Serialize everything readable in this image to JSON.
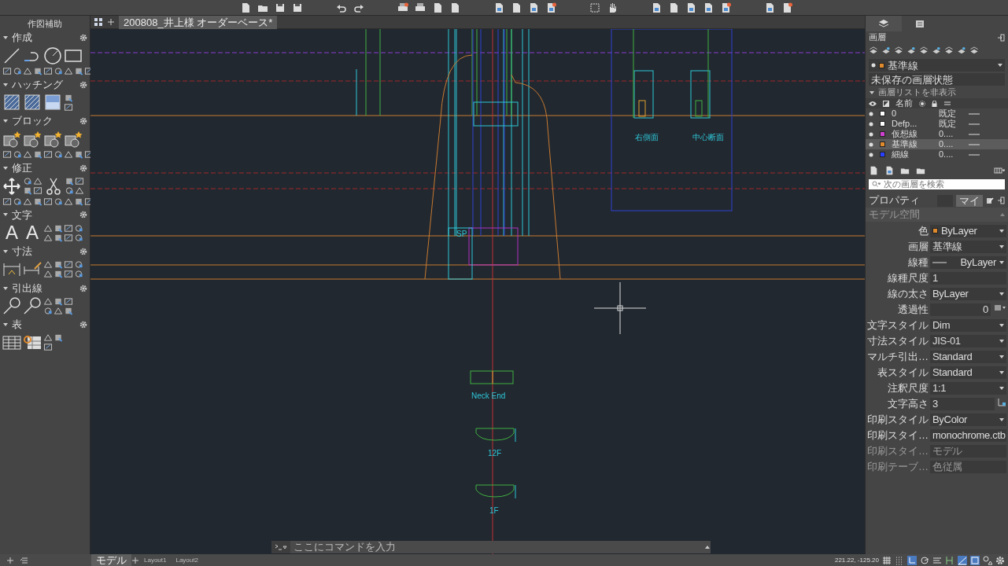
{
  "palette": {
    "title": "作図補助",
    "sections": [
      {
        "title": "作成",
        "expanded": true
      },
      {
        "title": "ハッチング",
        "expanded": true
      },
      {
        "title": "ブロック",
        "expanded": true
      },
      {
        "title": "修正",
        "expanded": true
      },
      {
        "title": "文字",
        "expanded": true,
        "glyphs": [
          "A",
          "A"
        ]
      },
      {
        "title": "寸法",
        "expanded": true
      },
      {
        "title": "引出線",
        "expanded": true
      },
      {
        "title": "表",
        "expanded": true
      }
    ]
  },
  "document_tabs": [
    {
      "label": "200808_井上様 オーダーベース*",
      "selected": true
    }
  ],
  "canvas": {
    "labels": [
      {
        "text": "右側面"
      },
      {
        "text": "中心断面"
      },
      {
        "text": "SP"
      },
      {
        "text": "Neck End"
      },
      {
        "text": "12F"
      },
      {
        "text": "1F"
      }
    ]
  },
  "command_line": {
    "placeholder": "ここにコマンドを入力"
  },
  "layers_panel": {
    "title": "画層",
    "current_layer": {
      "name": "基準線",
      "color": "#e08a2e"
    },
    "layer_state": "未保存の画層状態",
    "list_toggle": {
      "label": "画層リストを非表示",
      "expanded": true
    },
    "name_header": "名前",
    "search_placeholder": "次の画層を検索",
    "layers": [
      {
        "name": "0",
        "color": "#ffffff",
        "column_4": "既定",
        "selected": false
      },
      {
        "name": "Defp...",
        "color": "#ffffff",
        "column_4": "既定",
        "selected": false
      },
      {
        "name": "仮想線",
        "color": "#d040d0",
        "column_4": "0....",
        "selected": false
      },
      {
        "name": "基準線",
        "color": "#e08a2e",
        "column_4": "0....",
        "selected": true
      },
      {
        "name": "細線",
        "color": "#2a40ff",
        "column_4": "0....",
        "selected": false
      }
    ]
  },
  "properties_panel": {
    "title": "プロパティ",
    "mine_toggle": {
      "label": "マイ",
      "selected": true
    },
    "section": "モデル空間",
    "rows": [
      {
        "label": "色",
        "value": "ByLayer",
        "kind": "color",
        "color": "#e08a2e"
      },
      {
        "label": "画層",
        "value": "基準線",
        "kind": "dropdown"
      },
      {
        "label": "線種",
        "value": "ByLayer",
        "kind": "linetype"
      },
      {
        "label": "線種尺度",
        "value": "1",
        "kind": "input"
      },
      {
        "label": "線の太さ",
        "value": "ByLayer",
        "kind": "dropdown"
      },
      {
        "label": "透過性",
        "value": "0",
        "kind": "transparency"
      },
      {
        "label": "文字スタイル",
        "value": "Dim",
        "kind": "dropdown"
      },
      {
        "label": "寸法スタイル",
        "value": "JIS-01",
        "kind": "dropdown"
      },
      {
        "label": "マルチ引出…",
        "value": "Standard",
        "kind": "dropdown"
      },
      {
        "label": "表スタイル",
        "value": "Standard",
        "kind": "dropdown"
      },
      {
        "label": "注釈尺度",
        "value": "1:1",
        "kind": "dropdown"
      },
      {
        "label": "文字高さ",
        "value": "3",
        "kind": "pick"
      },
      {
        "label": "印刷スタイル",
        "value": "ByColor",
        "kind": "dropdown"
      },
      {
        "label": "印刷スタイ…",
        "value": "monochrome.ctb",
        "kind": "dropdown"
      },
      {
        "label": "印刷スタイ…",
        "value": "モデル",
        "kind": "disabled"
      },
      {
        "label": "印刷テーブ…",
        "value": "色従属",
        "kind": "disabled"
      }
    ]
  },
  "layout_tabs": [
    {
      "label": "モデル",
      "selected": true
    },
    {
      "label": "Layout1",
      "selected": false
    },
    {
      "label": "Layout2",
      "selected": false
    }
  ],
  "status_bar": {
    "coordinates": "221.22, -125.20"
  }
}
